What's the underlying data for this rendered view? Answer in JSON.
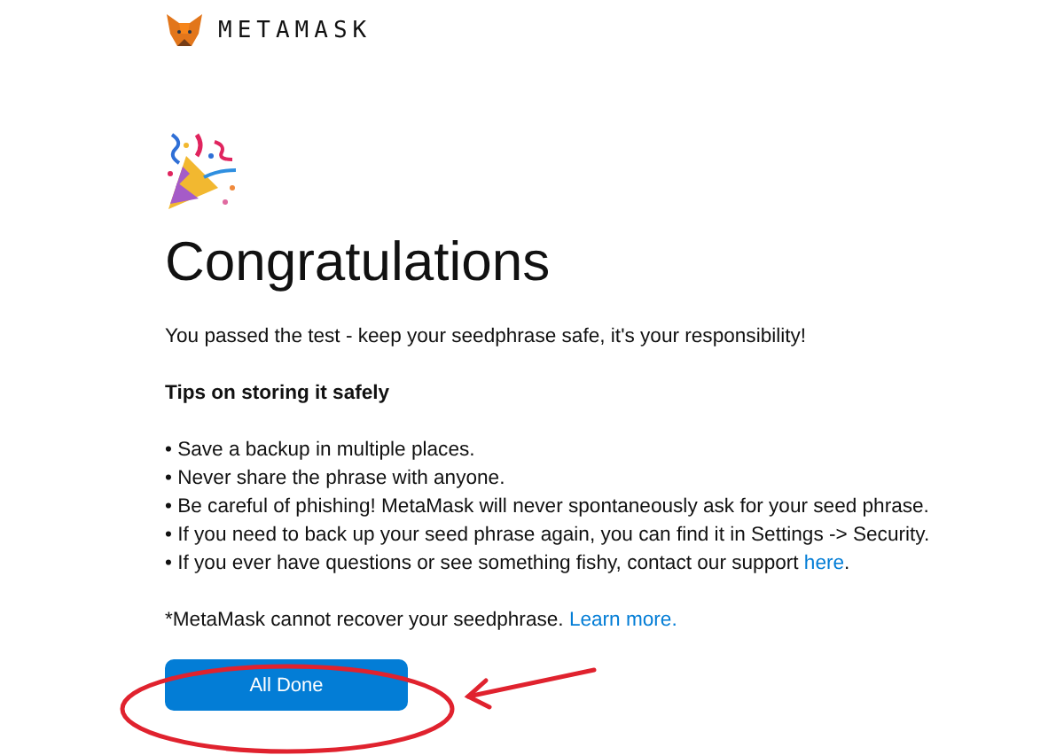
{
  "brand": {
    "wordmark": "METAMASK"
  },
  "title": "Congratulations",
  "intro": "You passed the test - keep your seedphrase safe, it's your responsibility!",
  "tips_heading": "Tips on storing it safely",
  "tips": [
    {
      "text": "• Save a backup in multiple places."
    },
    {
      "text": "• Never share the phrase with anyone."
    },
    {
      "text": "• Be careful of phishing! MetaMask will never spontaneously ask for your seed phrase."
    },
    {
      "text": "• If you need to back up your seed phrase again, you can find it in Settings -> Security."
    },
    {
      "text": "• If you ever have questions or see something fishy, contact our support ",
      "link": "here",
      "after": "."
    }
  ],
  "note": {
    "text": "*MetaMask cannot recover your seedphrase. ",
    "link": "Learn more."
  },
  "button": {
    "label": "All Done"
  }
}
